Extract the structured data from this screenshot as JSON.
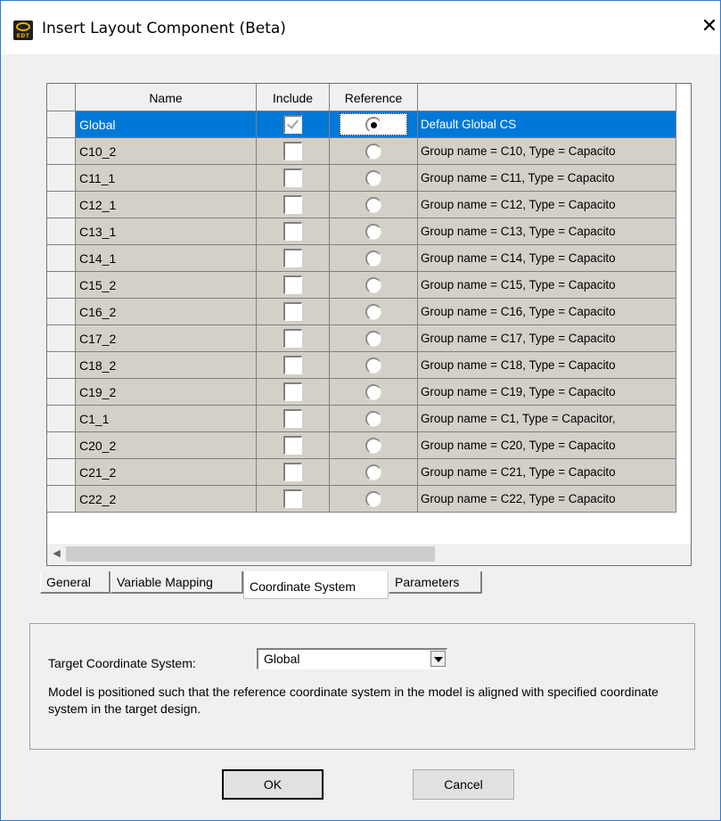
{
  "window": {
    "title": "Insert Layout Component (Beta)",
    "icon_text": "EDT",
    "close": "✕"
  },
  "grid": {
    "columns": [
      "Name",
      "Include",
      "Reference",
      ""
    ],
    "rows": [
      {
        "name": "Global",
        "include": true,
        "reference": true,
        "desc": "Default Global CS",
        "selected": true
      },
      {
        "name": "C10_2",
        "include": false,
        "reference": false,
        "desc": "Group name = C10, Type = Capacito"
      },
      {
        "name": "C11_1",
        "include": false,
        "reference": false,
        "desc": "Group name = C11, Type = Capacito"
      },
      {
        "name": "C12_1",
        "include": false,
        "reference": false,
        "desc": "Group name = C12, Type = Capacito"
      },
      {
        "name": "C13_1",
        "include": false,
        "reference": false,
        "desc": "Group name = C13, Type = Capacito"
      },
      {
        "name": "C14_1",
        "include": false,
        "reference": false,
        "desc": "Group name = C14, Type = Capacito"
      },
      {
        "name": "C15_2",
        "include": false,
        "reference": false,
        "desc": "Group name = C15, Type = Capacito"
      },
      {
        "name": "C16_2",
        "include": false,
        "reference": false,
        "desc": "Group name = C16, Type = Capacito"
      },
      {
        "name": "C17_2",
        "include": false,
        "reference": false,
        "desc": "Group name = C17, Type = Capacito"
      },
      {
        "name": "C18_2",
        "include": false,
        "reference": false,
        "desc": "Group name = C18, Type = Capacito"
      },
      {
        "name": "C19_2",
        "include": false,
        "reference": false,
        "desc": "Group name = C19, Type = Capacito"
      },
      {
        "name": "C1_1",
        "include": false,
        "reference": false,
        "desc": "Group name = C1, Type = Capacitor,"
      },
      {
        "name": "C20_2",
        "include": false,
        "reference": false,
        "desc": "Group name = C20, Type = Capacito"
      },
      {
        "name": "C21_2",
        "include": false,
        "reference": false,
        "desc": "Group name = C21, Type = Capacito"
      },
      {
        "name": "C22_2",
        "include": false,
        "reference": false,
        "desc": "Group name = C22, Type = Capacito"
      }
    ]
  },
  "tabs": [
    "General",
    "Variable Mapping",
    "Coordinate System",
    "Parameters"
  ],
  "active_tab": "Coordinate System",
  "panel": {
    "target_label": "Target Coordinate System:",
    "target_value": "Global",
    "description": "Model is positioned such that the reference coordinate system in the model is aligned with specified coordinate system in the target design."
  },
  "buttons": {
    "ok": "OK",
    "cancel": "Cancel"
  },
  "colors": {
    "selection": "#0078d7",
    "cell_bg": "#d4d0c8",
    "dialog_bg": "#f0f0f0"
  }
}
